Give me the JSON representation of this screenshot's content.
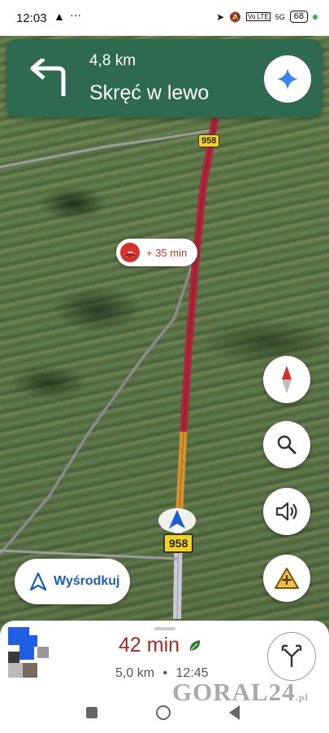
{
  "status_bar": {
    "time": "12:03",
    "network": "5G",
    "volte": "Vo LTE",
    "battery": "68"
  },
  "nav_banner": {
    "distance": "4,8 km",
    "instruction": "Skręć w lewo",
    "turn_icon": "turn-left-icon",
    "background_color": "#2e6a4f"
  },
  "map": {
    "road_labels": [
      "958",
      "958"
    ],
    "traffic_delay": "+ 35 min",
    "route_colors": {
      "heavy": "#b0243a",
      "moderate": "#d4902a",
      "clear": "#c9c9d6"
    }
  },
  "buttons": {
    "recenter_label": "Wyśrodkuj",
    "compass": "compass-icon",
    "search": "search-icon",
    "sound": "sound-icon",
    "report": "report-incident-icon"
  },
  "bottom_sheet": {
    "eta": "42 min",
    "distance": "5,0 km",
    "separator": "•",
    "arrival_time": "12:45",
    "alternate_routes": "alt-routes-icon"
  },
  "watermark": {
    "text": "GORAL24",
    "suffix": ".pl"
  }
}
